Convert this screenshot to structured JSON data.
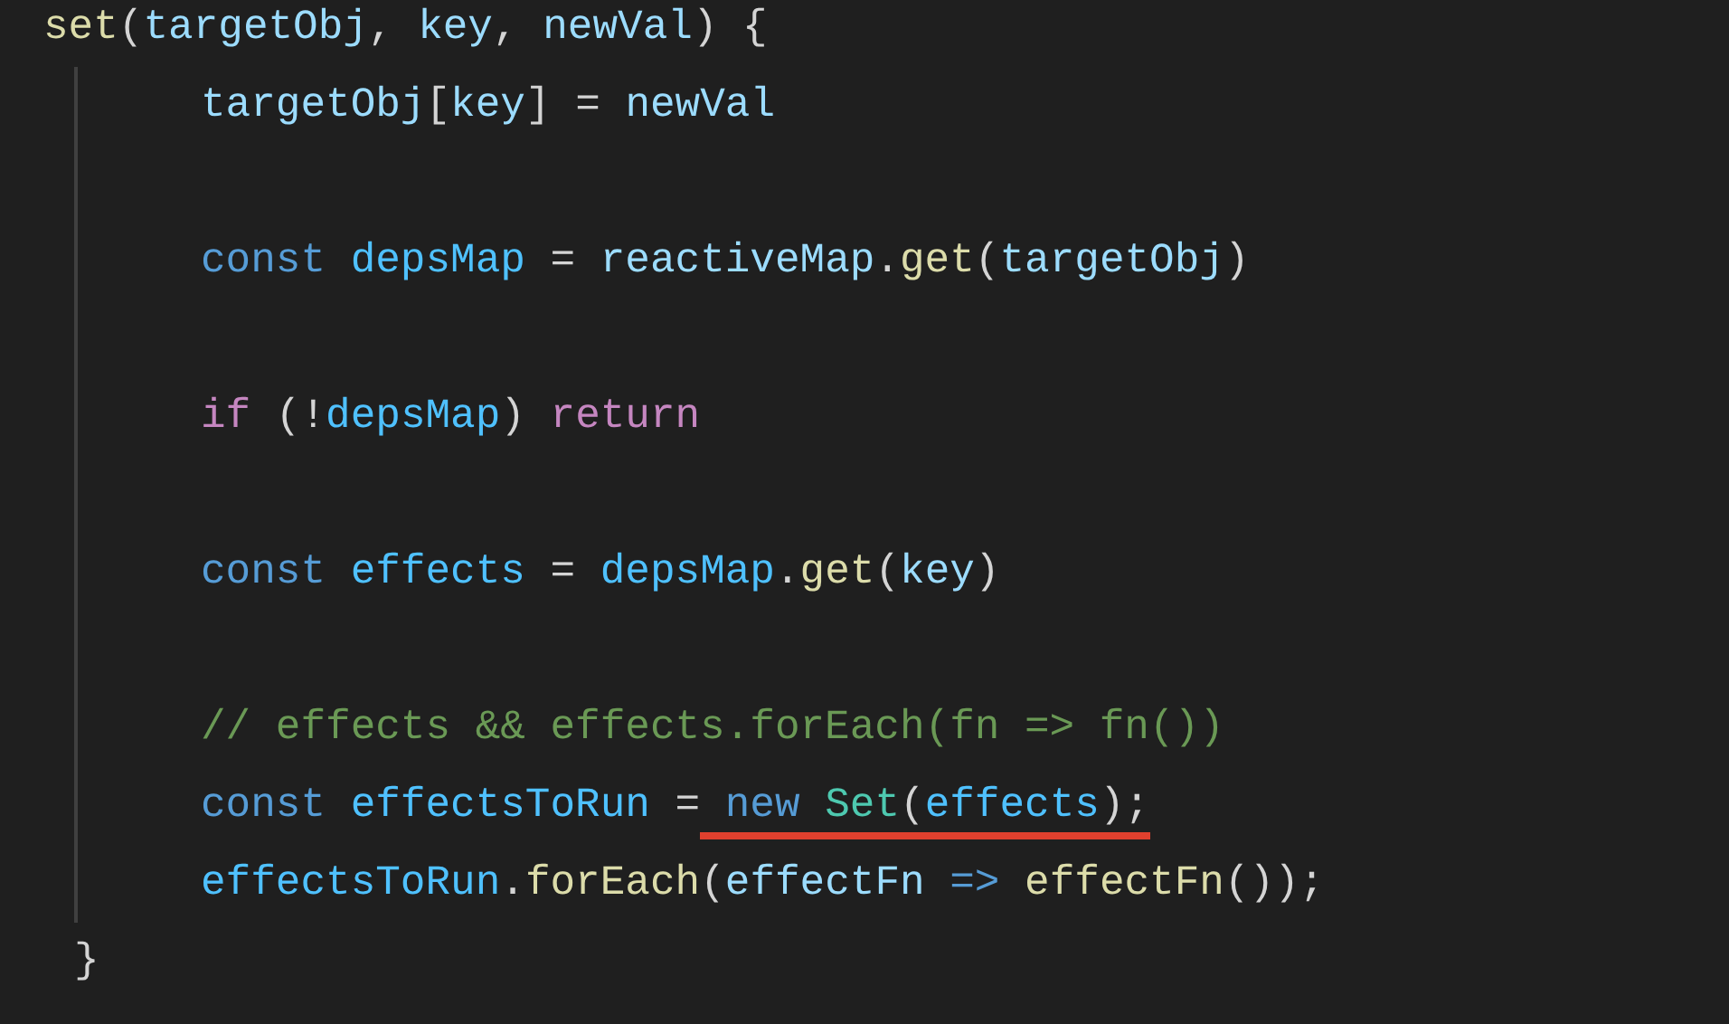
{
  "editor": {
    "lines": [
      {
        "kind": "open",
        "tokens": [
          {
            "text": "set",
            "kind": "function"
          },
          {
            "text": "(",
            "kind": "plain"
          },
          {
            "text": "targetObj",
            "kind": "variable"
          },
          {
            "text": ", ",
            "kind": "plain"
          },
          {
            "text": "key",
            "kind": "variable"
          },
          {
            "text": ", ",
            "kind": "plain"
          },
          {
            "text": "newVal",
            "kind": "variable"
          },
          {
            "text": ") {",
            "kind": "plain"
          }
        ]
      },
      {
        "kind": "body",
        "tokens": [
          {
            "text": "targetObj",
            "kind": "variable"
          },
          {
            "text": "[",
            "kind": "plain"
          },
          {
            "text": "key",
            "kind": "variable"
          },
          {
            "text": "] = ",
            "kind": "plain"
          },
          {
            "text": "newVal",
            "kind": "variable"
          }
        ]
      },
      {
        "kind": "blank"
      },
      {
        "kind": "body",
        "tokens": [
          {
            "text": "const",
            "kind": "keyword"
          },
          {
            "text": " depsMap",
            "kind": "constant"
          },
          {
            "text": " = ",
            "kind": "plain"
          },
          {
            "text": "reactiveMap",
            "kind": "variable"
          },
          {
            "text": ".",
            "kind": "plain"
          },
          {
            "text": "get",
            "kind": "function"
          },
          {
            "text": "(",
            "kind": "plain"
          },
          {
            "text": "targetObj",
            "kind": "variable"
          },
          {
            "text": ")",
            "kind": "plain"
          }
        ]
      },
      {
        "kind": "blank"
      },
      {
        "kind": "body",
        "tokens": [
          {
            "text": "if",
            "kind": "control"
          },
          {
            "text": " (!",
            "kind": "plain"
          },
          {
            "text": "depsMap",
            "kind": "constant"
          },
          {
            "text": ") ",
            "kind": "plain"
          },
          {
            "text": "return",
            "kind": "control"
          }
        ]
      },
      {
        "kind": "blank"
      },
      {
        "kind": "body",
        "tokens": [
          {
            "text": "const",
            "kind": "keyword"
          },
          {
            "text": " effects",
            "kind": "constant"
          },
          {
            "text": " = ",
            "kind": "plain"
          },
          {
            "text": "depsMap",
            "kind": "constant"
          },
          {
            "text": ".",
            "kind": "plain"
          },
          {
            "text": "get",
            "kind": "function"
          },
          {
            "text": "(",
            "kind": "plain"
          },
          {
            "text": "key",
            "kind": "variable"
          },
          {
            "text": ")",
            "kind": "plain"
          }
        ]
      },
      {
        "kind": "blank"
      },
      {
        "kind": "body",
        "tokens": [
          {
            "text": "// effects && effects.forEach(fn => fn())",
            "kind": "comment"
          }
        ]
      },
      {
        "kind": "body",
        "tokens": [
          {
            "text": "const",
            "kind": "keyword"
          },
          {
            "text": " effectsToRun",
            "kind": "constant"
          },
          {
            "text": " =",
            "kind": "plain"
          },
          {
            "kind": "group",
            "underlined": true,
            "tokens": [
              {
                "text": " new",
                "kind": "keyword"
              },
              {
                "text": " Set",
                "kind": "class"
              },
              {
                "text": "(",
                "kind": "plain"
              },
              {
                "text": "effects",
                "kind": "constant"
              },
              {
                "text": ");",
                "kind": "plain"
              }
            ]
          }
        ]
      },
      {
        "kind": "body",
        "tokens": [
          {
            "text": "effectsToRun",
            "kind": "constant"
          },
          {
            "text": ".",
            "kind": "plain"
          },
          {
            "text": "forEach",
            "kind": "function"
          },
          {
            "text": "(",
            "kind": "plain"
          },
          {
            "text": "effectFn",
            "kind": "variable"
          },
          {
            "text": " =>",
            "kind": "keyword"
          },
          {
            "text": " effectFn",
            "kind": "function"
          },
          {
            "text": "());",
            "kind": "plain"
          }
        ]
      },
      {
        "kind": "close",
        "tokens": [
          {
            "text": "}",
            "kind": "plain"
          }
        ]
      }
    ]
  }
}
